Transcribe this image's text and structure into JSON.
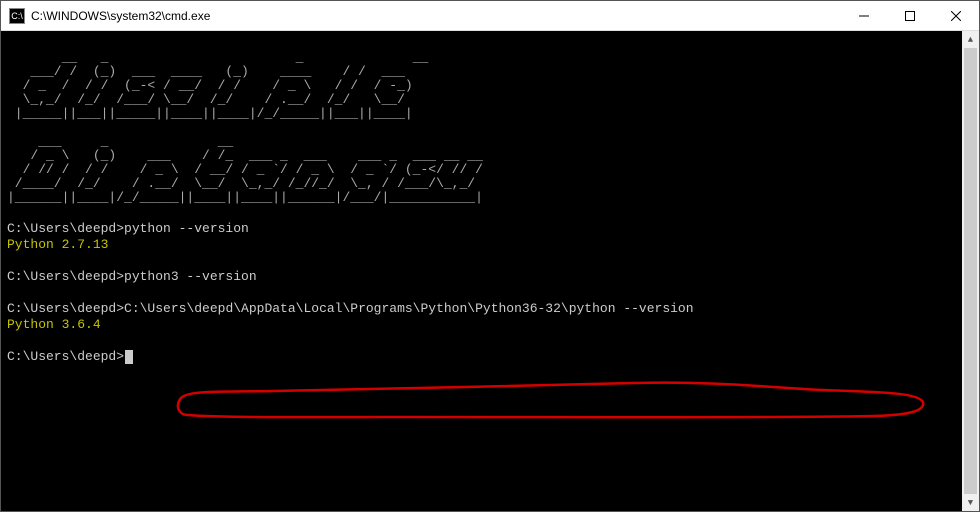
{
  "window": {
    "title": "C:\\WINDOWS\\system32\\cmd.exe"
  },
  "ascii": {
    "line1": "       __   _                        _              __",
    "line2": "   ___/ /  (_)  ___  ____   (_)    ____    / /  ___",
    "line3": "  / _  /  / /  (_-< / __/  / /    / _ \\   / /  / -_)",
    "line4": "  \\_,_/  /_/  /___/ \\__/  /_/    / .__/  /_/   \\__/",
    "line5": " |_____||___||_____||____||____|/_/_____||___||____|",
    "line6": "",
    "line7": "    ___     _              __",
    "line8": "   / _ \\   (_)    ___    / /_  ___ _  ___    ___ _  ___ __ __",
    "line9": "  / // /  / /    / _ \\  / __/ / _ `/ / _ \\  / _ `/ (_-</ // /",
    "line10": " /____/  /_/    / .__/  \\__/  \\_,_/ /_//_/  \\_, / /___/\\_,_/",
    "line11": "|______||____|/_/_____||____||____||______|/___/|___________|"
  },
  "lines": {
    "prompt1": "C:\\Users\\deepd>python --version",
    "out1": "Python 2.7.13",
    "prompt2": "C:\\Users\\deepd>python3 --version",
    "prompt3_prefix": "C:\\Users\\deepd>",
    "prompt3_cmd": "C:\\Users\\deepd\\AppData\\Local\\Programs\\Python\\Python36-32\\python --version",
    "out3": "Python 3.6.4",
    "prompt4": "C:\\Users\\deepd>"
  },
  "colors": {
    "annotation": "#d40000"
  }
}
